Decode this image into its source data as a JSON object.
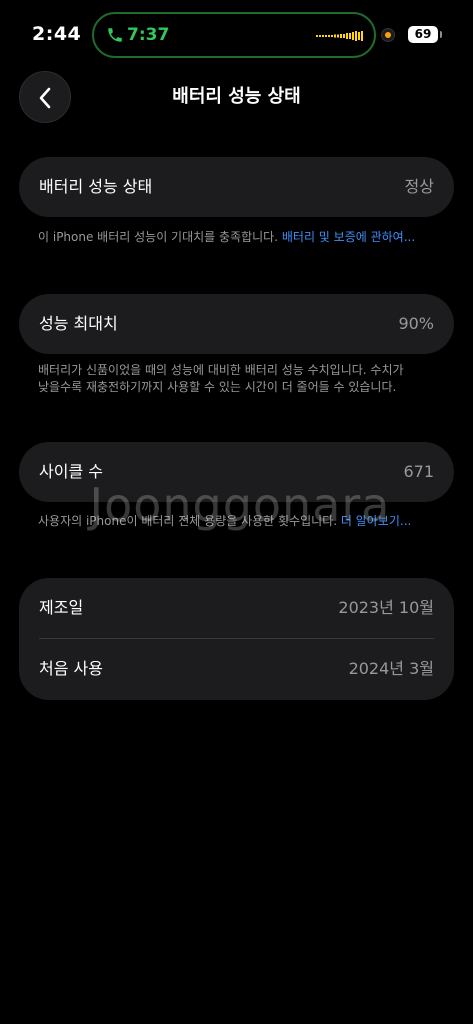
{
  "status_bar": {
    "time": "2:44",
    "call_time": "7:37",
    "battery_level": "69",
    "call_color": "#34c759",
    "indicator_color": "#ff9f0a",
    "icons": [
      "phone-icon",
      "waveform-icon",
      "recording-indicator-icon",
      "battery-icon"
    ]
  },
  "nav": {
    "title": "배터리 성능 상태",
    "back_icon": "chevron-left-icon"
  },
  "sections": {
    "health": {
      "label": "배터리 성능 상태",
      "value": "정상",
      "footnote": "이 iPhone 배터리 성능이 기대치를 충족합니다. ",
      "link": "배터리 및 보증에 관하여..."
    },
    "capacity": {
      "label": "성능 최대치",
      "value": "90%",
      "footnote": "배터리가 신품이었을 때의 성능에 대비한 배터리 성능 수치입니다. 수치가 낮을수록 재충전하기까지 사용할 수 있는 시간이 더 줄어들 수 있습니다."
    },
    "cycles": {
      "label": "사이클 수",
      "value": "671",
      "footnote": "사용자의 iPhone이 배터리 전체 용량을 사용한 횟수입니다. ",
      "link": "더 알아보기..."
    },
    "dates": {
      "manufactured_label": "제조일",
      "manufactured_value": "2023년 10월",
      "first_use_label": "처음 사용",
      "first_use_value": "2024년 3월"
    }
  },
  "watermark": "Joonggonara",
  "colors": {
    "background": "#000000",
    "card": "#1c1c1e",
    "link": "#3e8ef7",
    "secondary_text": "#98989d"
  }
}
